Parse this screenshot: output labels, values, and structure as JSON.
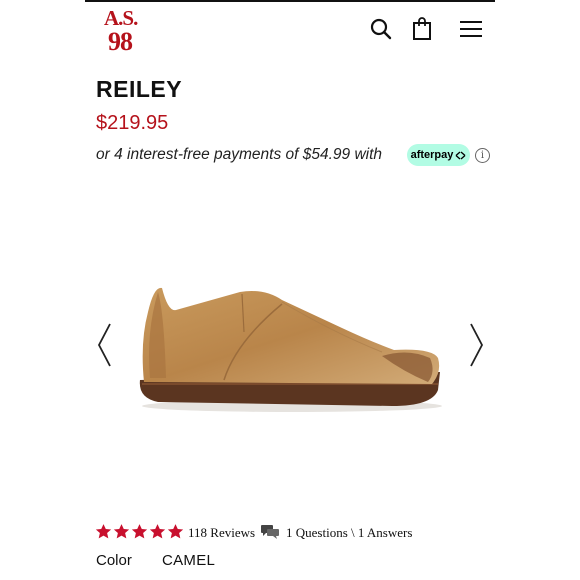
{
  "header": {
    "logo_line1": "A.S.",
    "logo_line2": "98",
    "search_icon": "search-icon",
    "bag_icon": "shopping-bag-icon",
    "menu_icon": "menu-icon"
  },
  "product": {
    "name": "REILEY",
    "price": "$219.95",
    "installments_text": "or 4 interest-free payments of $54.99 with",
    "afterpay_label": "afterpay",
    "info_glyph": "i",
    "price_color": "#b5121b"
  },
  "gallery": {
    "prev_icon": "chevron-left-icon",
    "next_icon": "chevron-right-icon"
  },
  "rating": {
    "stars": 5,
    "reviews_label": "118 Reviews",
    "qa_label": "1 Questions \\ 1 Answers",
    "star_color": "#c8102e"
  },
  "options": {
    "color_label": "Color",
    "color_value": "CAMEL"
  },
  "colors": {
    "brand": "#b5121b",
    "afterpay_bg": "#b2fce4"
  }
}
